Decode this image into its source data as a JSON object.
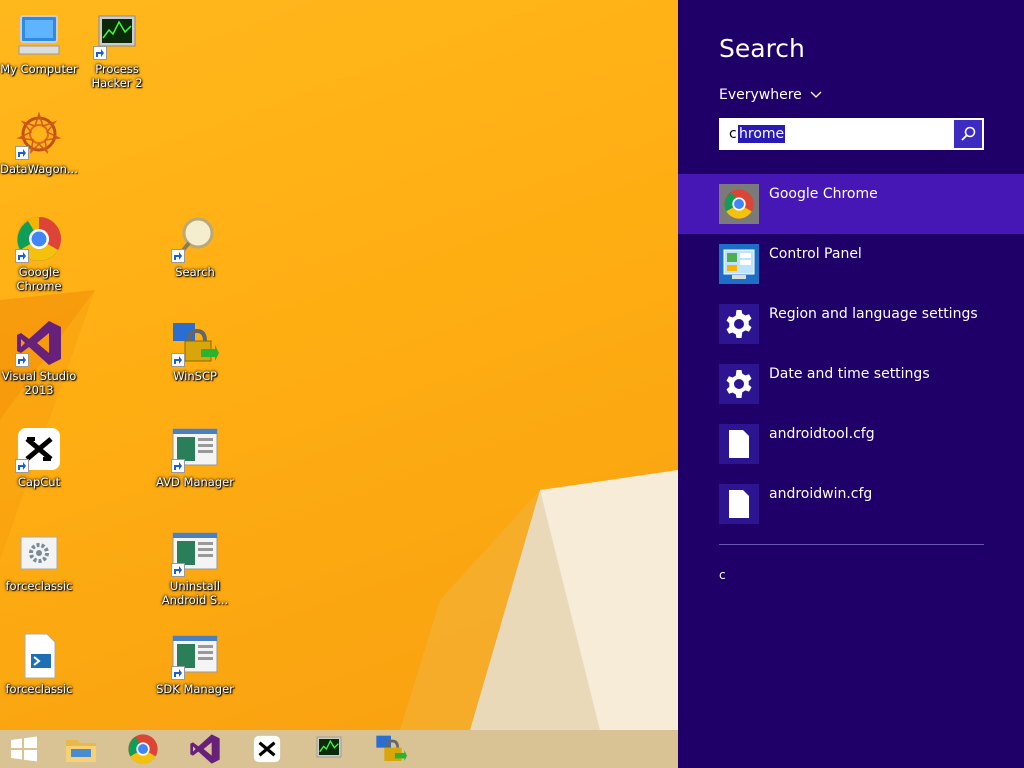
{
  "desktop": {
    "icons": [
      {
        "label": "My Computer"
      },
      {
        "label": "Process Hacker 2"
      },
      {
        "label": "DataWagon..."
      },
      {
        "label": "Google Chrome"
      },
      {
        "label": "Search"
      },
      {
        "label": "Visual Studio 2013"
      },
      {
        "label": "WinSCP"
      },
      {
        "label": "CapCut"
      },
      {
        "label": "AVD Manager"
      },
      {
        "label": "forceclassic"
      },
      {
        "label": "Uninstall Android S..."
      },
      {
        "label": "forceclassic"
      },
      {
        "label": "SDK Manager"
      }
    ]
  },
  "taskbar": {
    "items": [
      "start-icon",
      "file-explorer-icon",
      "chrome-icon",
      "visual-studio-icon",
      "capcut-icon",
      "process-hacker-icon",
      "winscp-icon"
    ]
  },
  "search_charm": {
    "title": "Search",
    "scope": "Everywhere",
    "query": "chrome",
    "query_first_char": "c",
    "query_selected": "hrome",
    "results": [
      {
        "label": "Google Chrome",
        "icon": "chrome-icon",
        "active": true
      },
      {
        "label": "Control Panel",
        "icon": "control-panel-icon",
        "active": false
      },
      {
        "label": "Region and language settings",
        "icon": "gear-icon",
        "active": false
      },
      {
        "label": "Date and time settings",
        "icon": "gear-icon",
        "active": false
      },
      {
        "label": "androidtool.cfg",
        "icon": "file-icon",
        "active": false
      },
      {
        "label": "androidwin.cfg",
        "icon": "file-icon",
        "active": false
      }
    ],
    "suggestion": "c"
  },
  "colors": {
    "charm_bg": "#1f0068",
    "active_result": "#4617b4",
    "wallpaper": "#ffae12"
  }
}
